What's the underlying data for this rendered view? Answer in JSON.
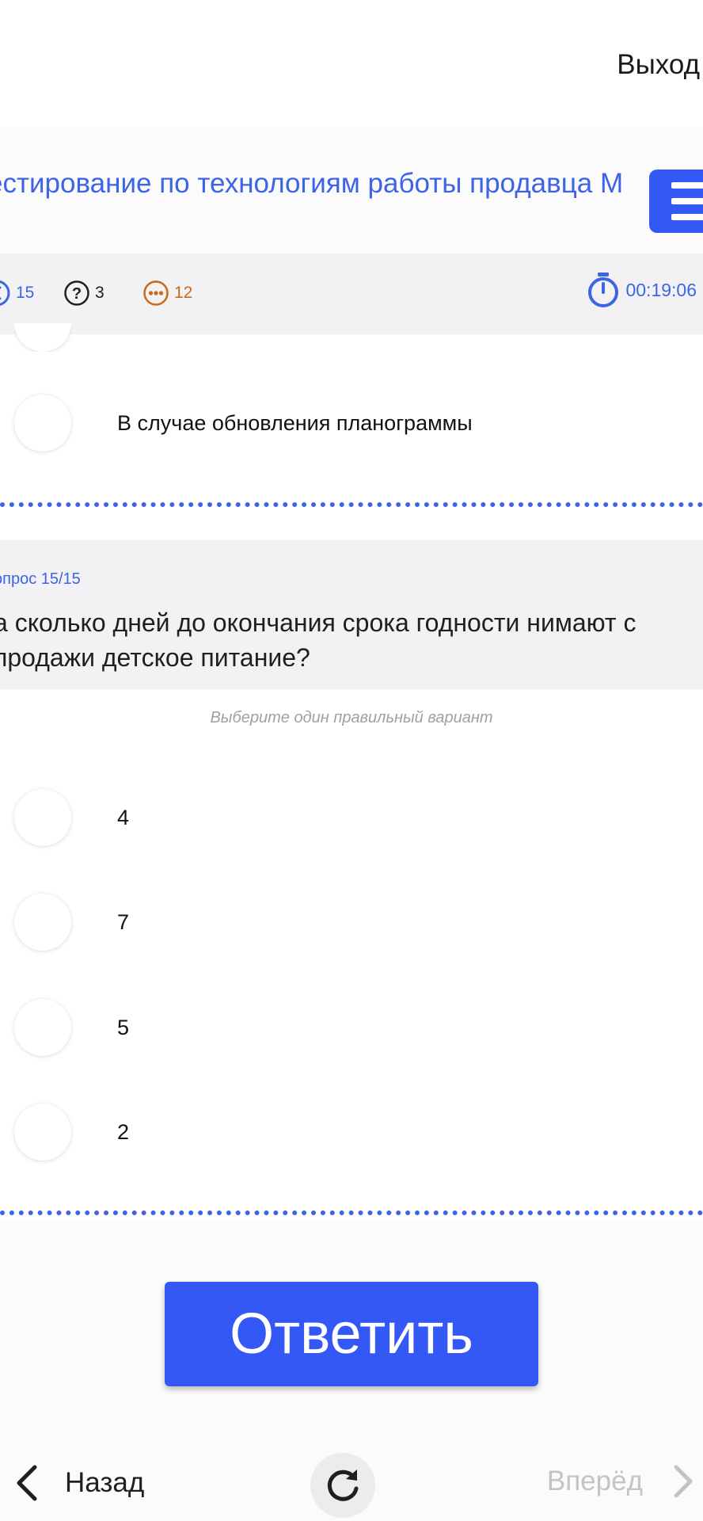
{
  "header": {
    "logout_label": "Выход",
    "title": "естирование по технологиям работы продавца М"
  },
  "status": {
    "answered_count": "15",
    "unknown_count": "3",
    "remaining_count": "12",
    "timer": "00:19:06"
  },
  "previous_question": {
    "last_answer": "В случае обновления планограммы"
  },
  "question": {
    "number": "опрос 15/15",
    "text": "а сколько дней до окончания срока годности нимают с продажи детское питание?",
    "hint": "Выберите один правильный вариант",
    "options": [
      "4",
      "7",
      "5",
      "2"
    ]
  },
  "actions": {
    "submit_label": "Ответить"
  },
  "navigation": {
    "back_label": "Назад",
    "forward_label": "Вперёд"
  },
  "colors": {
    "accent": "#3458f5",
    "link_blue": "#3d64e6",
    "orange": "#c96a1a"
  }
}
